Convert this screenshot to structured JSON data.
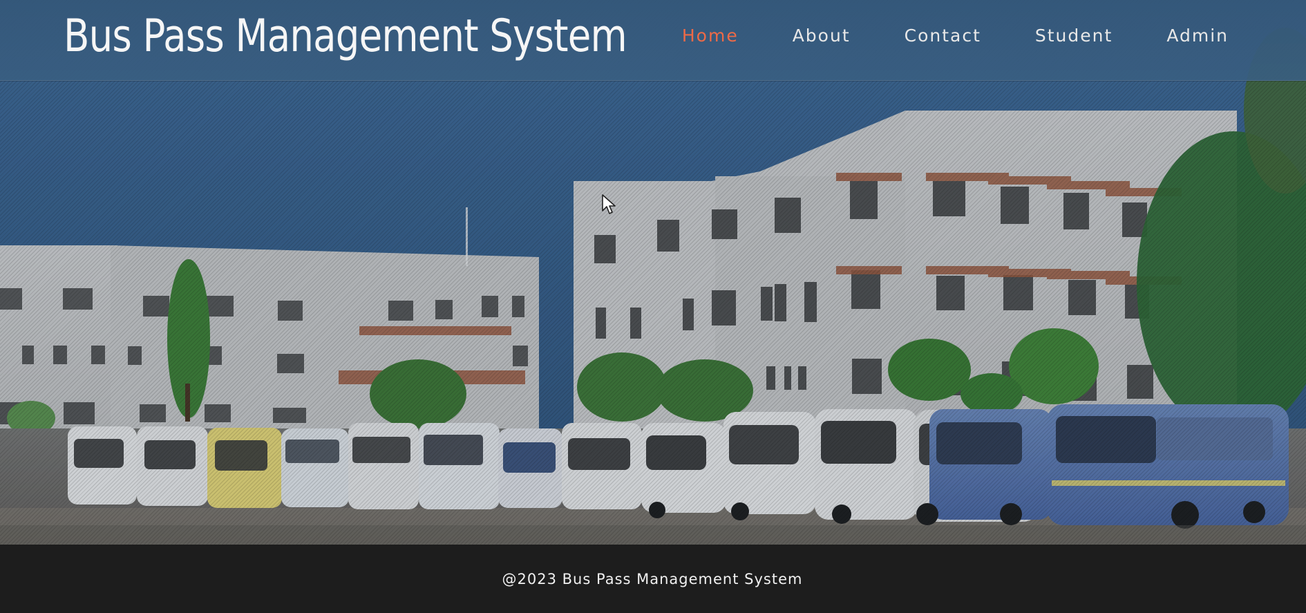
{
  "header": {
    "brand": "Bus Pass Management System",
    "nav": [
      {
        "label": "Home",
        "active": true
      },
      {
        "label": "About",
        "active": false
      },
      {
        "label": "Contact",
        "active": false
      },
      {
        "label": "Student",
        "active": false
      },
      {
        "label": "Admin",
        "active": false
      }
    ]
  },
  "footer": {
    "text": "@2023 Bus Pass Management System"
  },
  "hero": {
    "image_semantic": "campus-buildings-and-buses-photo"
  },
  "cursor": {
    "icon": "mouse-cursor-icon"
  },
  "colors": {
    "header_bg": "#3a5f84",
    "nav_text": "#e8e8e8",
    "nav_active": "#ee6a47",
    "footer_bg": "#1d1d1d"
  }
}
